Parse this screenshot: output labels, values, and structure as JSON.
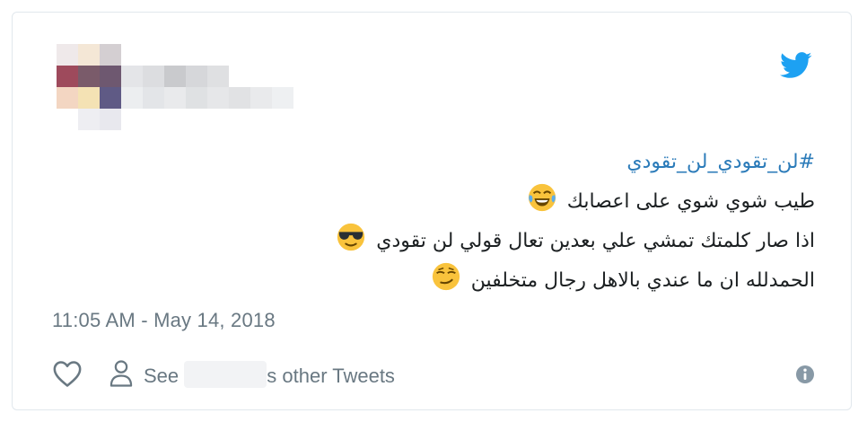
{
  "tweet": {
    "hashtag": "#لن_تقودي_لن_تقودي",
    "lines": [
      "طيب شوي شوي على اعصابك",
      "اذا صار كلمتك تمشي علي بعدين تعال قولي لن تقودي",
      "الحمدلله ان ما عندي بالاهل رجال متخلفين"
    ],
    "emojis": [
      "joy-emoji",
      "sunglasses-emoji",
      "smirk-emoji"
    ],
    "timestamp": "11:05 AM - May 14, 2018"
  },
  "actions": {
    "see_prefix": "See ",
    "see_suffix": "s other Tweets"
  },
  "colors": {
    "twitter_blue": "#1da1f2",
    "hashtag": "#2b7bb9",
    "muted": "#697882",
    "emoji_yellow": "#f9c33c"
  }
}
